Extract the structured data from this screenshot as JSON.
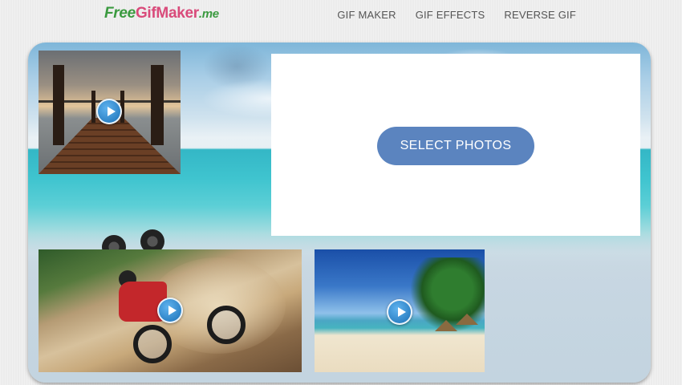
{
  "header": {
    "logo": {
      "part1": "Free",
      "part2": "GifMaker",
      "part3": ".me"
    },
    "nav": [
      "GIF MAKER",
      "GIF EFFECTS",
      "REVERSE GIF"
    ]
  },
  "upload": {
    "select_label": "SELECT PHOTOS",
    "button_color": "#5b84bf"
  },
  "thumbnails": [
    {
      "subject": "wooden pier at sunset",
      "icon": "play-icon"
    },
    {
      "subject": "motocross rider",
      "icon": "play-icon"
    },
    {
      "subject": "tropical beach",
      "icon": "play-icon"
    }
  ],
  "colors": {
    "logo_green": "#3a9a3f",
    "logo_pink": "#d94a7a",
    "nav_text": "#555555"
  }
}
